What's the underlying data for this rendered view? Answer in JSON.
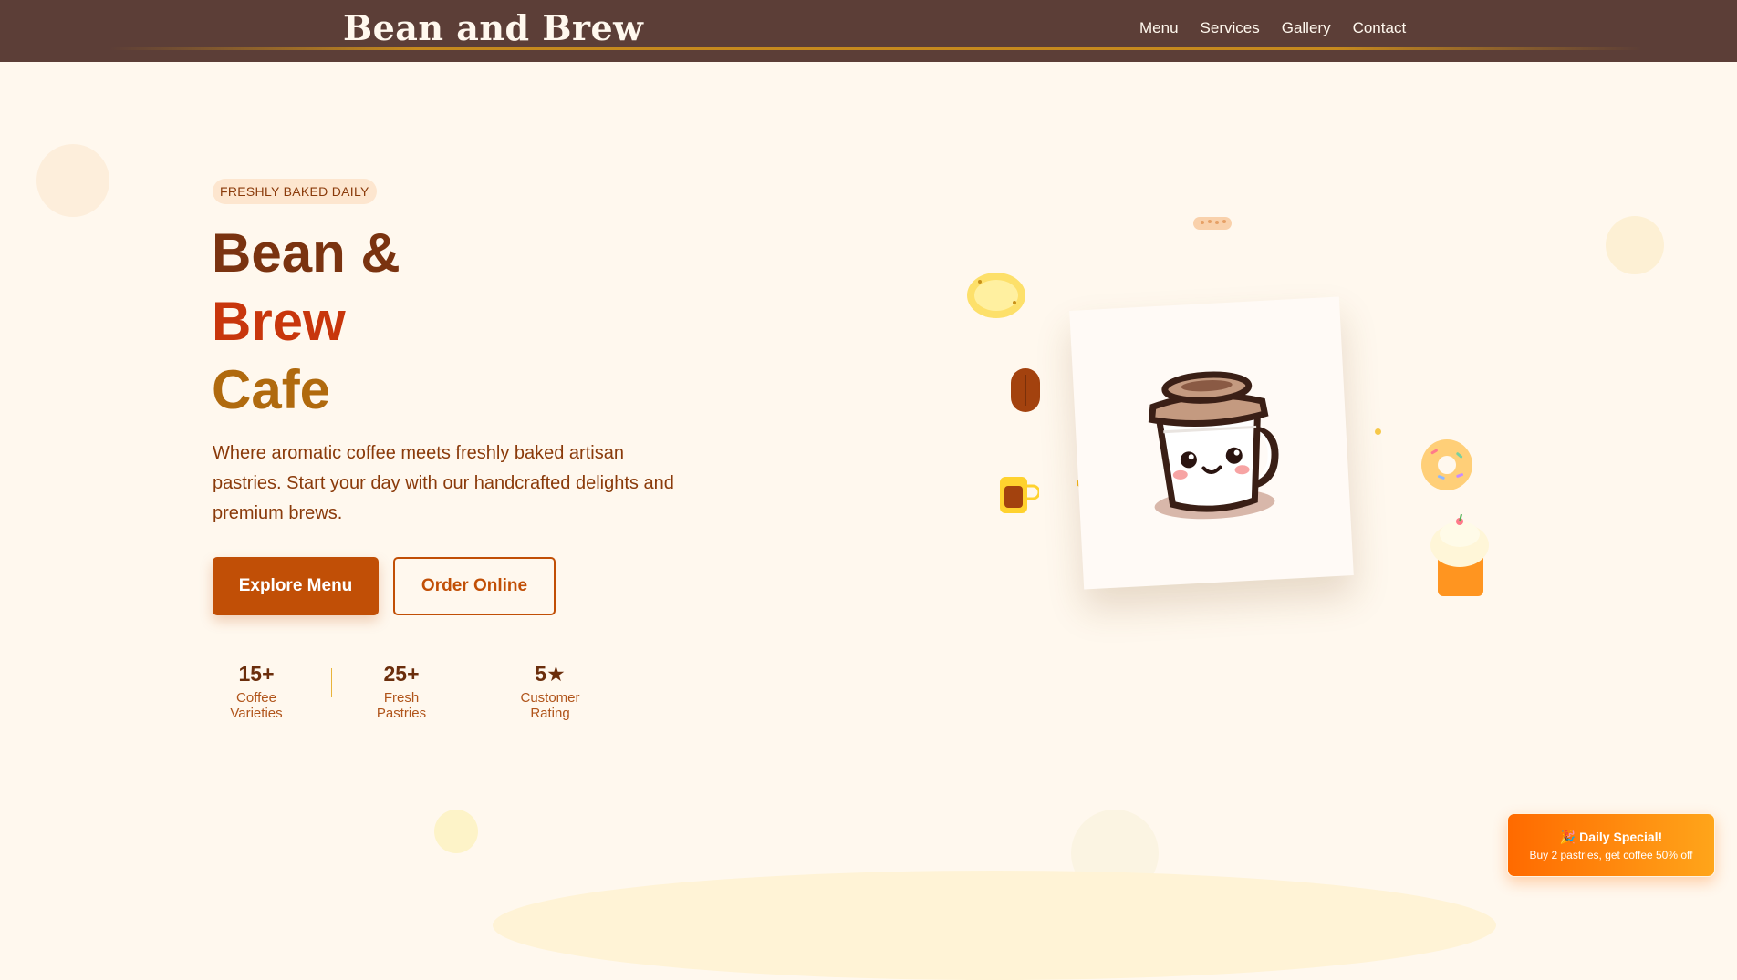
{
  "header": {
    "brand": "Bean and Brew",
    "nav": [
      "Menu",
      "Services",
      "Gallery",
      "Contact"
    ]
  },
  "hero": {
    "badge": "FRESHLY BAKED DAILY",
    "title_line1": "Bean &",
    "title_line2": "Brew",
    "title_line3": "Cafe",
    "description": "Where aromatic coffee meets freshly baked artisan pastries. Start your day with our handcrafted delights and premium brews.",
    "primary_button": "Explore Menu",
    "secondary_button": "Order Online"
  },
  "stats": [
    {
      "value": "15+",
      "label": "Coffee Varieties"
    },
    {
      "value": "25+",
      "label": "Fresh Pastries"
    },
    {
      "value": "5★",
      "label": "Customer Rating"
    }
  ],
  "promo": {
    "title": "🎉 Daily Special!",
    "subtitle": "Buy 2 pastries, get coffee 50% off"
  },
  "colors": {
    "header_bg": "#5c3e37",
    "page_bg": "#fff8ee",
    "accent": "#c14f06",
    "title_brown": "#7a3310",
    "title_red": "#c8360c",
    "title_gold": "#b06a0e"
  },
  "icons": [
    "coffee-cup-mascot-icon",
    "coffee-bean-icon",
    "beer-mug-icon",
    "bread-icon",
    "donut-icon",
    "cupcake-icon",
    "cookie-icon"
  ]
}
